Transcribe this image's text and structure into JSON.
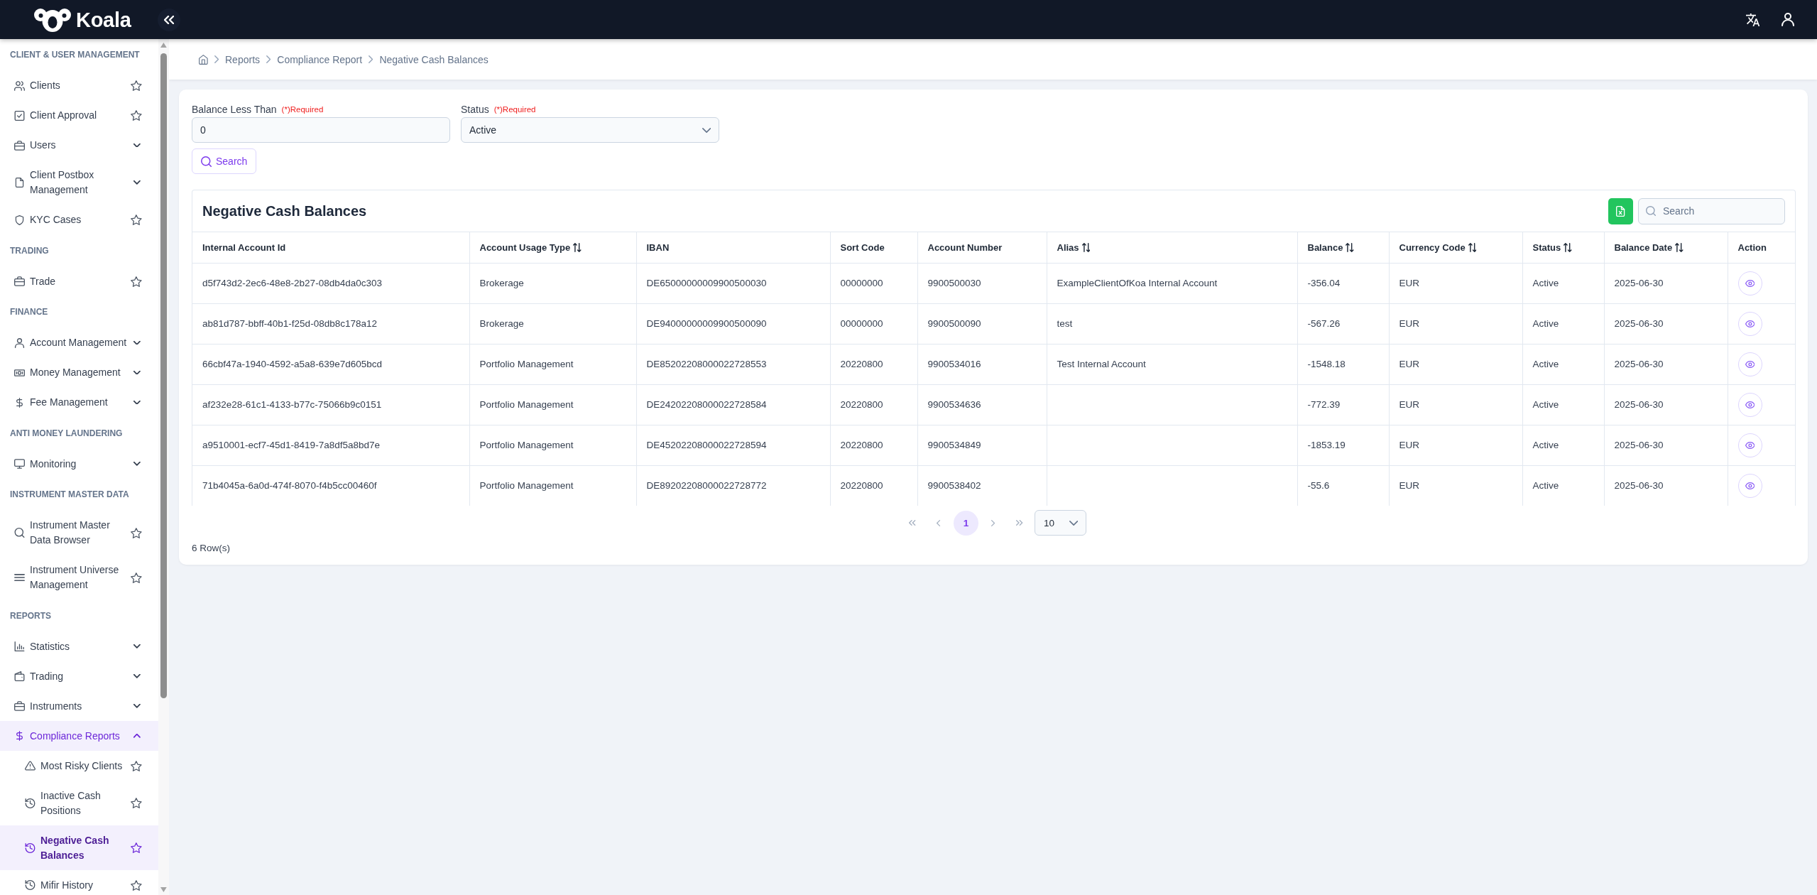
{
  "header": {
    "logo_text": "Koala"
  },
  "sidebar": {
    "sections": [
      {
        "title": "CLIENT & USER MANAGEMENT",
        "items": [
          {
            "kind": "page",
            "label": "Clients",
            "selected": false
          },
          {
            "kind": "page",
            "label": "Client Approval",
            "selected": false
          },
          {
            "kind": "group",
            "label": "Users",
            "expanded": false
          },
          {
            "kind": "group",
            "label": "Client Postbox Management",
            "expanded": false
          },
          {
            "kind": "page",
            "label": "KYC Cases",
            "selected": false
          }
        ]
      },
      {
        "title": "TRADING",
        "items": [
          {
            "kind": "page",
            "label": "Trade",
            "selected": false
          }
        ]
      },
      {
        "title": "FINANCE",
        "items": [
          {
            "kind": "group",
            "label": "Account Management",
            "expanded": false
          },
          {
            "kind": "group",
            "label": "Money Management",
            "expanded": false
          },
          {
            "kind": "group",
            "label": "Fee Management",
            "expanded": false
          }
        ]
      },
      {
        "title": "ANTI MONEY LAUNDERING",
        "items": [
          {
            "kind": "group",
            "label": "Monitoring",
            "expanded": false
          }
        ]
      },
      {
        "title": "INSTRUMENT MASTER DATA",
        "items": [
          {
            "kind": "page",
            "label": "Instrument Master Data Browser",
            "selected": false
          },
          {
            "kind": "page",
            "label": "Instrument Universe Management",
            "selected": false
          }
        ]
      },
      {
        "title": "REPORTS",
        "items": [
          {
            "kind": "group",
            "label": "Statistics",
            "expanded": false
          },
          {
            "kind": "group",
            "label": "Trading",
            "expanded": false
          },
          {
            "kind": "group",
            "label": "Instruments",
            "expanded": false
          },
          {
            "kind": "group",
            "label": "Compliance Reports",
            "expanded": true,
            "children": [
              {
                "kind": "page",
                "label": "Most Risky Clients",
                "selected": false
              },
              {
                "kind": "page",
                "label": "Inactive Cash Positions",
                "selected": false
              },
              {
                "kind": "page",
                "label": "Negative Cash Balances",
                "selected": true
              },
              {
                "kind": "page",
                "label": "Mifir History",
                "selected": false
              }
            ]
          }
        ]
      }
    ]
  },
  "breadcrumb": [
    "Reports",
    "Compliance Report",
    "Negative Cash Balances"
  ],
  "filters": [
    {
      "kind": "input",
      "label": "Balance Less Than",
      "required_note": "(*)Required",
      "value": "0"
    },
    {
      "kind": "select",
      "label": "Status",
      "required_note": "(*)Required",
      "value": "Active"
    }
  ],
  "search_button": "Search",
  "table": {
    "title": "Negative Cash Balances",
    "search": {
      "placeholder": "Search"
    },
    "columns": [
      {
        "label": "Internal Account Id",
        "sortable": false
      },
      {
        "label": "Account Usage Type",
        "sortable": true
      },
      {
        "label": "IBAN",
        "sortable": false
      },
      {
        "label": "Sort Code",
        "sortable": false
      },
      {
        "label": "Account Number",
        "sortable": false
      },
      {
        "label": "Alias",
        "sortable": true
      },
      {
        "label": "Balance",
        "sortable": true
      },
      {
        "label": "Currency Code",
        "sortable": true
      },
      {
        "label": "Status",
        "sortable": true
      },
      {
        "label": "Balance Date",
        "sortable": true
      },
      {
        "label": "Action",
        "sortable": false
      }
    ],
    "rows": [
      {
        "internal_account_id": "d5f743d2-2ec6-48e8-2b27-08db4da0c303",
        "account_usage_type": "Brokerage",
        "iban": "DE65000000009900500030",
        "sort_code": "00000000",
        "account_number": "9900500030",
        "alias": "ExampleClientOfKoa Internal Account",
        "balance": "-356.04",
        "currency_code": "EUR",
        "status": "Active",
        "balance_date": "2025-06-30"
      },
      {
        "internal_account_id": "ab81d787-bbff-40b1-f25d-08db8c178a12",
        "account_usage_type": "Brokerage",
        "iban": "DE94000000009900500090",
        "sort_code": "00000000",
        "account_number": "9900500090",
        "alias": "test",
        "balance": "-567.26",
        "currency_code": "EUR",
        "status": "Active",
        "balance_date": "2025-06-30"
      },
      {
        "internal_account_id": "66cbf47a-1940-4592-a5a8-639e7d605bcd",
        "account_usage_type": "Portfolio Management",
        "iban": "DE85202208000022728553",
        "sort_code": "20220800",
        "account_number": "9900534016",
        "alias": "Test Internal Account",
        "balance": "-1548.18",
        "currency_code": "EUR",
        "status": "Active",
        "balance_date": "2025-06-30"
      },
      {
        "internal_account_id": "af232e28-61c1-4133-b77c-75066b9c0151",
        "account_usage_type": "Portfolio Management",
        "iban": "DE24202208000022728584",
        "sort_code": "20220800",
        "account_number": "9900534636",
        "balance": "-772.39",
        "currency_code": "EUR",
        "status": "Active",
        "balance_date": "2025-06-30"
      },
      {
        "internal_account_id": "a9510001-ecf7-45d1-8419-7a8df5a8bd7e",
        "account_usage_type": "Portfolio Management",
        "iban": "DE45202208000022728594",
        "sort_code": "20220800",
        "account_number": "9900534849",
        "balance": "-1853.19",
        "currency_code": "EUR",
        "status": "Active",
        "balance_date": "2025-06-30"
      },
      {
        "internal_account_id": "71b4045a-6a0d-474f-8070-f4b5cc00460f",
        "account_usage_type": "Portfolio Management",
        "iban": "DE89202208000022728772",
        "sort_code": "20220800",
        "account_number": "9900538402",
        "balance": "-55.6",
        "currency_code": "EUR",
        "status": "Active",
        "balance_date": "2025-06-30"
      }
    ]
  },
  "pagination": {
    "first": {
      "disabled": true
    },
    "previous": {
      "disabled": true
    },
    "pages": [
      {
        "label": "1",
        "selected": true
      }
    ],
    "next": {
      "disabled": true
    },
    "last": {
      "disabled": true
    },
    "page_size": "10"
  },
  "row_count": "6 Row(s)"
}
